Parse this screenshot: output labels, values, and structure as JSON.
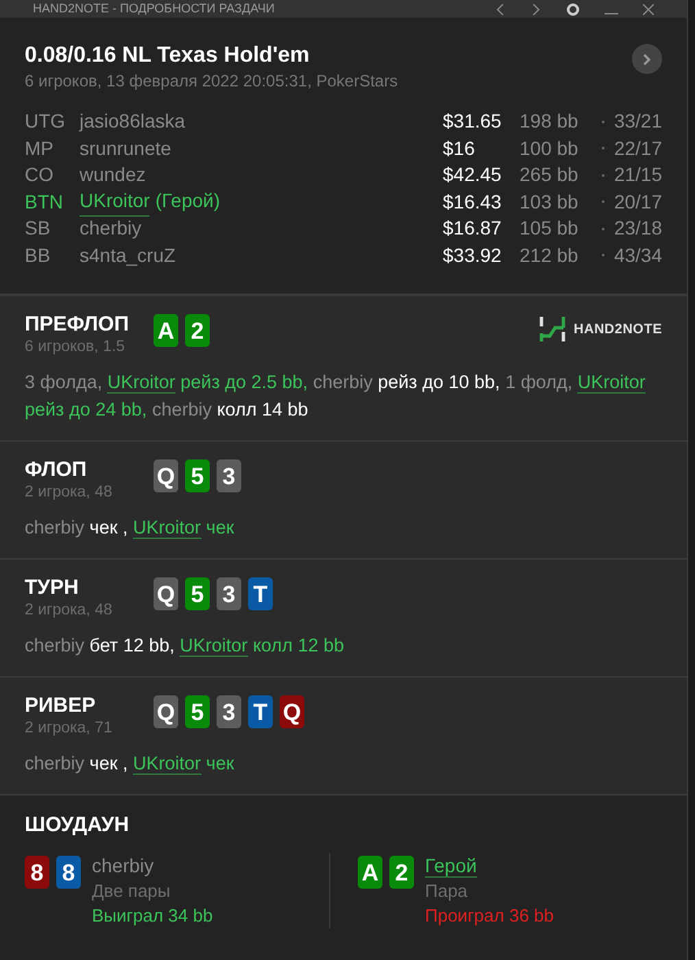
{
  "window": {
    "title": "HAND2NOTE - ПОДРОБНОСТИ РАЗДАЧИ"
  },
  "header": {
    "title": "0.08/0.16 NL Texas Hold'em",
    "subtitle": "6 игроков, 13 февраля 2022 20:05:31, PokerStars"
  },
  "players": [
    {
      "position": "UTG",
      "name": "jasio86laska",
      "hero": false,
      "stack": "$31.65",
      "bb": "198 bb",
      "stats": "33/21"
    },
    {
      "position": "MP",
      "name": "srunrunete",
      "hero": false,
      "stack": "$16",
      "bb": "100 bb",
      "stats": "22/17"
    },
    {
      "position": "CO",
      "name": "wundez",
      "hero": false,
      "stack": "$42.45",
      "bb": "265 bb",
      "stats": "21/15"
    },
    {
      "position": "BTN",
      "name": "UKroitor",
      "hero": true,
      "hero_tag": "(Герой)",
      "stack": "$16.43",
      "bb": "103 bb",
      "stats": "20/17"
    },
    {
      "position": "SB",
      "name": "cherbiy",
      "hero": false,
      "stack": "$16.87",
      "bb": "105 bb",
      "stats": "23/18"
    },
    {
      "position": "BB",
      "name": "s4nta_cruZ",
      "hero": false,
      "stack": "$33.92",
      "bb": "212 bb",
      "stats": "43/34"
    }
  ],
  "streets": [
    {
      "name": "ПРЕФЛОП",
      "info": "6 игроков, 1.5",
      "logo": "HAND2NOTE",
      "cards": [
        {
          "rank": "A",
          "color": "#0a8a0a"
        },
        {
          "rank": "2",
          "color": "#0a8a0a"
        }
      ],
      "actions": [
        {
          "kind": "info",
          "text": "3 фолда,"
        },
        {
          "kind": "hero",
          "text": "UKroitor"
        },
        {
          "kind": "hero_action",
          "text": "рейз до 2.5 bb,"
        },
        {
          "kind": "player",
          "text": "cherbiy"
        },
        {
          "kind": "action",
          "text": "рейз до 10 bb,"
        },
        {
          "kind": "info",
          "text": "1 фолд,"
        },
        {
          "kind": "hero",
          "text": "UKroitor"
        },
        {
          "kind": "hero_action",
          "text": "рейз до 24 bb,"
        },
        {
          "kind": "player",
          "text": "cherbiy"
        },
        {
          "kind": "action",
          "text": "колл 14 bb"
        }
      ]
    },
    {
      "name": "ФЛОП",
      "info": "2 игрока, 48",
      "cards": [
        {
          "rank": "Q",
          "color": "#5c5c5c"
        },
        {
          "rank": "5",
          "color": "#0a8a0a"
        },
        {
          "rank": "3",
          "color": "#5c5c5c"
        }
      ],
      "actions": [
        {
          "kind": "player",
          "text": "cherbiy"
        },
        {
          "kind": "action",
          "text": "чек ,"
        },
        {
          "kind": "hero",
          "text": "UKroitor"
        },
        {
          "kind": "hero_action",
          "text": "чек"
        }
      ]
    },
    {
      "name": "ТУРН",
      "info": "2 игрока, 48",
      "cards": [
        {
          "rank": "Q",
          "color": "#5c5c5c"
        },
        {
          "rank": "5",
          "color": "#0a8a0a"
        },
        {
          "rank": "3",
          "color": "#5c5c5c"
        },
        {
          "rank": "T",
          "color": "#0b5aa6"
        }
      ],
      "actions": [
        {
          "kind": "player",
          "text": "cherbiy"
        },
        {
          "kind": "action",
          "text": "бет 12 bb,"
        },
        {
          "kind": "hero",
          "text": "UKroitor"
        },
        {
          "kind": "hero_action",
          "text": "колл 12 bb"
        }
      ]
    },
    {
      "name": "РИВЕР",
      "info": "2 игрока, 71",
      "cards": [
        {
          "rank": "Q",
          "color": "#5c5c5c"
        },
        {
          "rank": "5",
          "color": "#0a8a0a"
        },
        {
          "rank": "3",
          "color": "#5c5c5c"
        },
        {
          "rank": "T",
          "color": "#0b5aa6"
        },
        {
          "rank": "Q",
          "color": "#8c0a0a"
        }
      ],
      "actions": [
        {
          "kind": "player",
          "text": "cherbiy"
        },
        {
          "kind": "action",
          "text": "чек ,"
        },
        {
          "kind": "hero",
          "text": "UKroitor"
        },
        {
          "kind": "hero_action",
          "text": "чек"
        }
      ]
    }
  ],
  "showdown": {
    "title": "ШОУДАУН",
    "hands": [
      {
        "cards": [
          {
            "rank": "8",
            "color": "#8c0a0a"
          },
          {
            "rank": "8",
            "color": "#0b5aa6"
          }
        ],
        "name": "cherbiy",
        "hero": false,
        "combo": "Две пары",
        "result": "Выиграл 34 bb",
        "won": true
      },
      {
        "cards": [
          {
            "rank": "A",
            "color": "#0a8a0a"
          },
          {
            "rank": "2",
            "color": "#0a8a0a"
          }
        ],
        "name": "Герой",
        "hero": true,
        "combo": "Пара",
        "result": "Проиграл 36 bb",
        "won": false
      }
    ]
  }
}
